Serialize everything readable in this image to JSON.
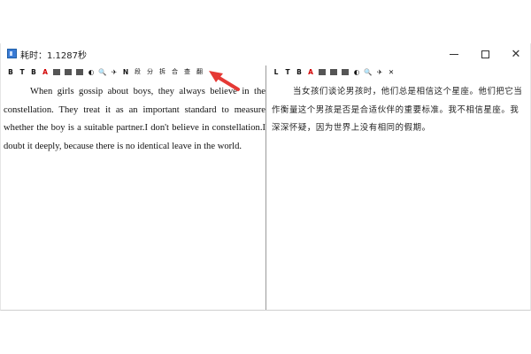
{
  "window": {
    "title": "耗时：1.1287秒",
    "controls": {
      "minimize": "",
      "maximize": "",
      "close": "✕"
    }
  },
  "left_pane": {
    "toolbar": [
      "B",
      "T",
      "B",
      "A",
      "",
      "",
      "",
      "◐",
      "🔍",
      "✈",
      "N",
      "段",
      "分",
      "拆",
      "合",
      "查",
      "翻"
    ],
    "text": "When girls gossip about boys, they always believe in the constellation. They treat it as an important standard to measure whether the boy is a suitable partner.I don't believe in constellation.I doubt it deeply, because there is no identical leave in the world."
  },
  "right_pane": {
    "toolbar": [
      "L",
      "T",
      "B",
      "A",
      "",
      "",
      "",
      "◐",
      "🔍",
      "✈",
      "✕"
    ],
    "text": "当女孩们谈论男孩时，他们总是相信这个星座。他们把它当作衡量这个男孩是否是合适伙伴的重要标准。我不相信星座。我深深怀疑，因为世界上没有相同的假期。"
  },
  "annotation": {
    "arrow_color": "#e53935"
  }
}
